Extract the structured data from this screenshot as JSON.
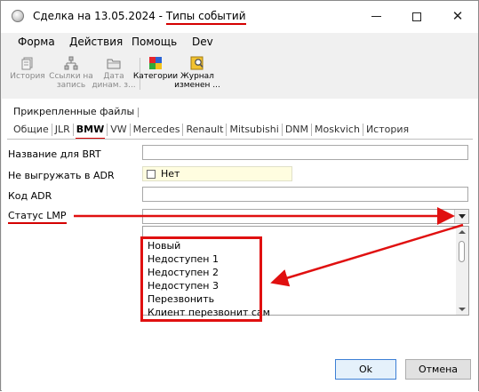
{
  "window": {
    "title_prefix": "Сделка на 13.05.2024 - ",
    "title_highlight": "Типы событий"
  },
  "menu": [
    "Форма",
    "Действия",
    "Помощь",
    "Dev"
  ],
  "toolbar": [
    {
      "label": "История",
      "icon": "history-icon",
      "enabled": false
    },
    {
      "label": "Ссылки на запись",
      "icon": "links-icon",
      "enabled": false
    },
    {
      "label": "Дата динам. з...",
      "icon": "folder-date-icon",
      "enabled": false
    },
    {
      "label": "Категории",
      "icon": "categories-icon",
      "enabled": true
    },
    {
      "label": "Журнал изменен ...",
      "icon": "journal-search-icon",
      "enabled": true
    }
  ],
  "group_tab": "Прикрепленные файлы",
  "tabs": [
    "Общие",
    "JLR",
    "BMW",
    "VW",
    "Mercedes",
    "Renault",
    "Mitsubishi",
    "DNM",
    "Moskvich",
    "История"
  ],
  "active_tab": "BMW",
  "fields": {
    "brt_label": "Название для BRT",
    "brt_value": "",
    "adr_export_label": "Не выгружать в ADR",
    "adr_export_checkbox_label": "Нет",
    "adr_export_checked": false,
    "adr_code_label": "Код ADR",
    "adr_code_value": "",
    "lmp_label": "Статус LMP",
    "lmp_value": ""
  },
  "dropdown_options": [
    "Новый",
    "Недоступен 1",
    "Недоступен 2",
    "Недоступен 3",
    "Перезвонить",
    "Клиент перезвонит сам"
  ],
  "buttons": {
    "ok": "Ok",
    "cancel": "Отмена"
  },
  "colors": {
    "annotation_red": "#e01010",
    "window_bg": "#f0f0f0"
  }
}
